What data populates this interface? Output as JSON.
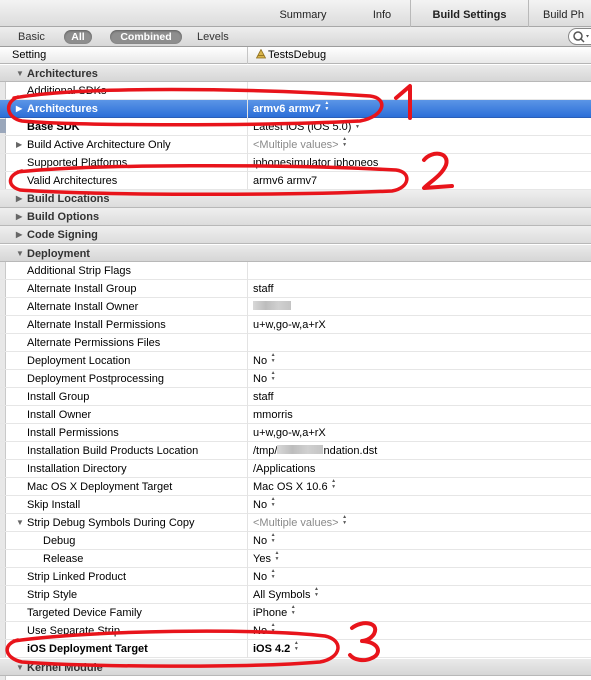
{
  "tabs": [
    {
      "label": "Summary"
    },
    {
      "label": "Info"
    },
    {
      "label": "Build Settings"
    },
    {
      "label": "Build Ph"
    }
  ],
  "filter": {
    "basic": "Basic",
    "all": "All",
    "combined": "Combined",
    "levels": "Levels"
  },
  "columns": {
    "setting": "Setting",
    "target": "TestsDebug"
  },
  "rows": [
    {
      "name": "Architectures",
      "type": "section"
    },
    {
      "name": "Additional SDKs",
      "value": ""
    },
    {
      "name": "Architectures",
      "value": "armv6 armv7",
      "stepper": true,
      "selected": true
    },
    {
      "name": "Base SDK",
      "value": "Latest iOS (iOS 5.0)",
      "stepper": true
    },
    {
      "name": "Build Active Architecture Only",
      "value": "<Multiple values>",
      "stepper": true,
      "gray": true,
      "expandable": true
    },
    {
      "name": "Supported Platforms",
      "value": "iphonesimulator iphoneos"
    },
    {
      "name": "Valid Architectures",
      "value": "armv6 armv7"
    },
    {
      "name": "Build Locations",
      "type": "collapsed"
    },
    {
      "name": "Build Options",
      "type": "collapsed"
    },
    {
      "name": "Code Signing",
      "type": "collapsed"
    },
    {
      "name": "Deployment",
      "type": "section"
    },
    {
      "name": "Additional Strip Flags",
      "value": ""
    },
    {
      "name": "Alternate Install Group",
      "value": "staff"
    },
    {
      "name": "Alternate Install Owner",
      "value": "",
      "blurred": true
    },
    {
      "name": "Alternate Install Permissions",
      "value": "u+w,go-w,a+rX"
    },
    {
      "name": "Alternate Permissions Files",
      "value": ""
    },
    {
      "name": "Deployment Location",
      "value": "No",
      "stepper": true
    },
    {
      "name": "Deployment Postprocessing",
      "value": "No",
      "stepper": true
    },
    {
      "name": "Install Group",
      "value": "staff"
    },
    {
      "name": "Install Owner",
      "value": "mmorris"
    },
    {
      "name": "Install Permissions",
      "value": "u+w,go-w,a+rX"
    },
    {
      "name": "Installation Build Products Location",
      "value_prefix": "/tmp/",
      "value_suffix": "ndation.dst",
      "blurred_mid": true
    },
    {
      "name": "Installation Directory",
      "value": "/Applications"
    },
    {
      "name": "Mac OS X Deployment Target",
      "value": "Mac OS X 10.6",
      "stepper": true
    },
    {
      "name": "Skip Install",
      "value": "No",
      "stepper": true
    },
    {
      "name": "Strip Debug Symbols During Copy",
      "value": "<Multiple values>",
      "stepper": true,
      "gray": true,
      "expandable": true,
      "expanded": true
    },
    {
      "name": "Debug",
      "value": "No",
      "stepper": true,
      "sub": true
    },
    {
      "name": "Release",
      "value": "Yes",
      "stepper": true,
      "sub": true
    },
    {
      "name": "Strip Linked Product",
      "value": "No",
      "stepper": true
    },
    {
      "name": "Strip Style",
      "value": "All Symbols",
      "stepper": true
    },
    {
      "name": "Targeted Device Family",
      "value": "iPhone",
      "stepper": true
    },
    {
      "name": "Use Separate Strip",
      "value": "No",
      "stepper": true
    },
    {
      "name": "iOS Deployment Target",
      "value": "iOS 4.2",
      "stepper": true,
      "bold": true
    },
    {
      "name": "Kernel Module",
      "type": "section"
    }
  ],
  "annotations": [
    "1",
    "2",
    "3"
  ],
  "colors": {
    "annotation": "#e8141b",
    "selection": "#2c6fd8"
  }
}
